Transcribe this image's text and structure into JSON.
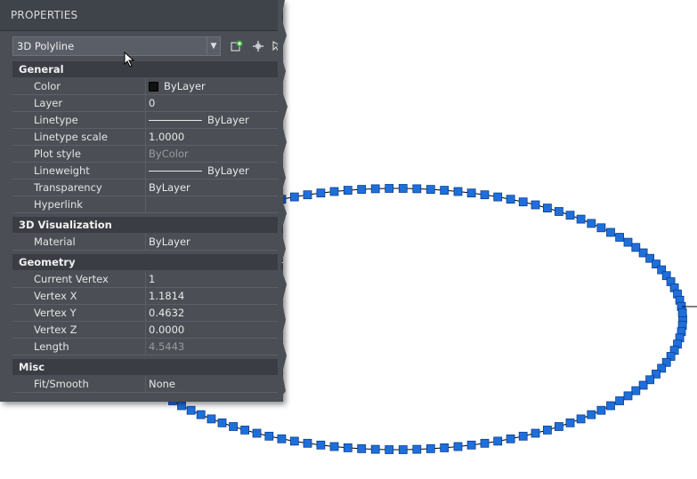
{
  "palette": {
    "panel_bg": "#4b4f55",
    "vertex_blue": "#1f6fdb",
    "line": "#000000"
  },
  "panel": {
    "title": "PROPERTIES",
    "object_type": "3D Polyline",
    "icons": [
      "quick-select-icon",
      "select-objects-icon",
      "toggle-pickadd-icon"
    ]
  },
  "sections": {
    "general": {
      "title": "General",
      "collapse_glyph": "–",
      "rows": [
        {
          "label": "Color",
          "value": "ByLayer"
        },
        {
          "label": "Layer",
          "value": "0"
        },
        {
          "label": "Linetype",
          "value": "ByLayer"
        },
        {
          "label": "Linetype scale",
          "value": "1.0000"
        },
        {
          "label": "Plot style",
          "value": "ByColor"
        },
        {
          "label": "Lineweight",
          "value": "ByLayer"
        },
        {
          "label": "Transparency",
          "value": "ByLayer"
        },
        {
          "label": "Hyperlink",
          "value": ""
        }
      ]
    },
    "visualization": {
      "title": "3D Visualization",
      "rows": [
        {
          "label": "Material",
          "value": "ByLayer"
        }
      ]
    },
    "geometry": {
      "title": "Geometry",
      "collapse_glyph": "–",
      "rows": [
        {
          "label": "Current Vertex",
          "value": "1"
        },
        {
          "label": "Vertex X",
          "value": "1.1814"
        },
        {
          "label": "Vertex Y",
          "value": "0.4632"
        },
        {
          "label": "Vertex Z",
          "value": "0.0000"
        },
        {
          "label": "Length",
          "value": "4.5443"
        }
      ]
    },
    "misc": {
      "title": "Misc",
      "collapse_glyph": "–",
      "rows": [
        {
          "label": "Fit/Smooth",
          "value": "None"
        }
      ]
    }
  },
  "drawing": {
    "vertex_count": 130
  }
}
